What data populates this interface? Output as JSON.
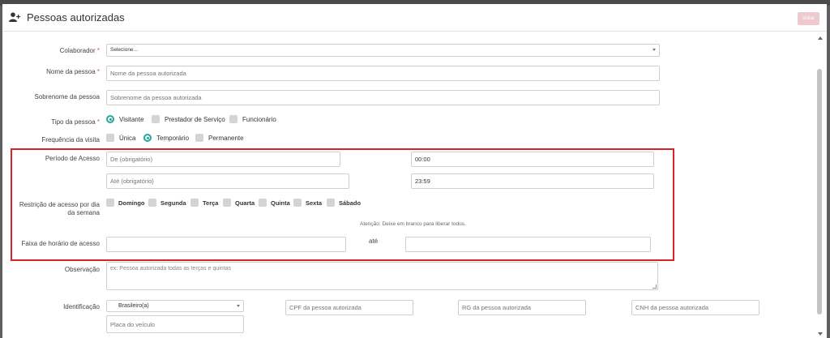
{
  "modal": {
    "title": "Pessoas autorizadas",
    "back_label": "Voltar"
  },
  "form": {
    "colaborador": {
      "label": "Colaborador",
      "required_mark": "*",
      "value": "Selecione..."
    },
    "nome": {
      "label": "Nome da pessoa",
      "required_mark": "*",
      "placeholder": "Nome da pessoa autorizada"
    },
    "sobrenome": {
      "label": "Sobrenome da pessoa",
      "placeholder": "Sobrenome da pessoa autorizada"
    },
    "tipo": {
      "label": "Tipo da pessoa",
      "required_mark": "*",
      "options": [
        "Visitante",
        "Prestador de Serviço",
        "Funcionário"
      ],
      "selected": "Visitante"
    },
    "frequencia": {
      "label": "Frequência da visita",
      "options": [
        "Única",
        "Temporário",
        "Permanente"
      ],
      "selected": "Temporário"
    },
    "periodo": {
      "label": "Período de Acesso",
      "start_date_placeholder": "De (obrigatório)",
      "start_time": "00:00",
      "end_date_placeholder": "Até (obrigatório)",
      "end_time": "23:59"
    },
    "restricao": {
      "label": "Restrição de acesso por dia da semana",
      "days": [
        "Domingo",
        "Segunda",
        "Terça",
        "Quarta",
        "Quinta",
        "Sexta",
        "Sábado"
      ],
      "note": "Atenção: Deixe em branco para liberar todos."
    },
    "faixa": {
      "label": "Faixa de horário de acesso",
      "ate_label": "até",
      "start_value": "",
      "end_value": ""
    },
    "observacao": {
      "label": "Observação",
      "placeholder": "ex: Pessoa autorizada todas as terças e quintas"
    },
    "identificacao": {
      "label": "Identificação",
      "nationality": "Brasileiro(a)",
      "cpf_placeholder": "CPF da pessoa autorizada",
      "rg_placeholder": "RG da pessoa autorizada",
      "cnh_placeholder": "CNH da pessoa autorizada",
      "placa_placeholder": "Placa do veículo"
    }
  },
  "colors": {
    "accent": "#26a69a",
    "highlight_border": "#d8232a",
    "back_button": "#f0c9cf"
  }
}
